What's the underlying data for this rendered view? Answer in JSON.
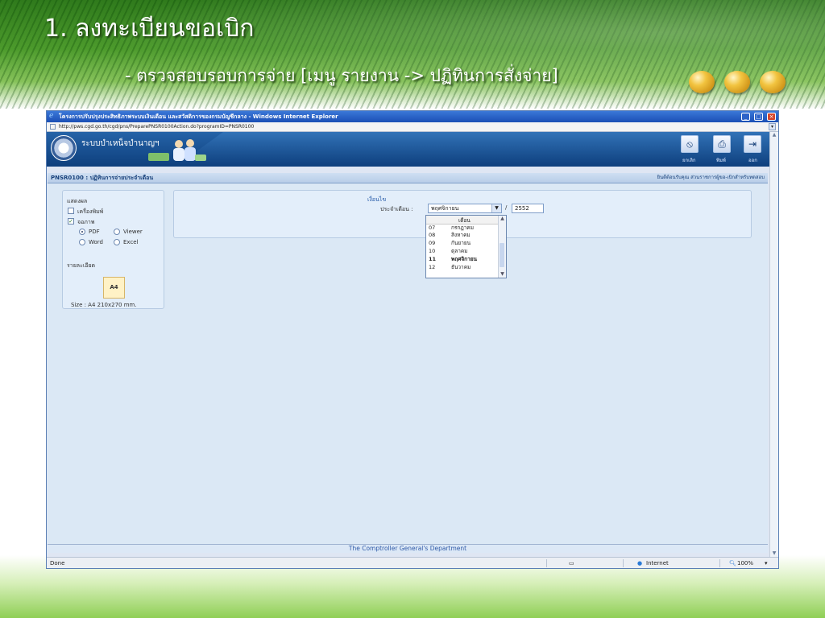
{
  "slide": {
    "title": "1. ลงทะเบียนขอเบิก",
    "subtitle": "- ตรวจสอบรอบการจ่าย [เมนู รายงาน -> ปฏิทินการสั่งจ่าย]"
  },
  "browser": {
    "window_title": "โครงการปรับปรุงประสิทธิภาพระบบเงินเดือน และสวัสดิการของกรมบัญชีกลาง - Windows Internet Explorer",
    "address": "http://pws.cgd.go.th/cgd/pns/PreparePNSR0100Action.do?programID=PNSR0100",
    "status_text": "Done",
    "zone": "Internet",
    "zoom": "100%"
  },
  "app": {
    "name": "ระบบบำเหน็จบำนาญฯ",
    "buttons": {
      "cancel": "ยกเลิก",
      "print": "พิมพ์",
      "exit": "ออก"
    },
    "page_code": "PNSR0100 : ปฏิทินการจ่ายประจำเดือน",
    "welcome": "ยินดีต้อนรับคุณ ส่วนราชการผู้ขอ-เบิกสำหรับทดสอบ",
    "footer": "The Comptroller General's Department"
  },
  "left_panel": {
    "display_label": "แสดงผล",
    "printer_label": "เครื่องพิมพ์",
    "screen_label": "จอภาพ",
    "pdf_label": "PDF",
    "viewer_label": "Viewer",
    "word_label": "Word",
    "excel_label": "Excel",
    "detail_label": "รายละเอียด",
    "paper_label": "A4",
    "size_text": "Size : A4 210x270 mm."
  },
  "condition": {
    "legend": "เงื่อนไข",
    "month_label": "ประจำเดือน :",
    "month_value": "พฤศจิกายน",
    "year_value": "2552",
    "list_header": "เดือน",
    "months": [
      {
        "num": "07",
        "name": "กรกฎาคม"
      },
      {
        "num": "08",
        "name": "สิงหาคม"
      },
      {
        "num": "09",
        "name": "กันยายน"
      },
      {
        "num": "10",
        "name": "ตุลาคม"
      },
      {
        "num": "11",
        "name": "พฤศจิกายน"
      },
      {
        "num": "12",
        "name": "ธันวาคม"
      }
    ]
  },
  "colors": {
    "header_blue": "#0e3f7d",
    "title_blue": "#17407a",
    "accent_link": "#2f5aa8"
  },
  "icons": {
    "cancel": "cancel-circle-icon",
    "print": "printer-icon",
    "exit": "exit-door-icon"
  }
}
